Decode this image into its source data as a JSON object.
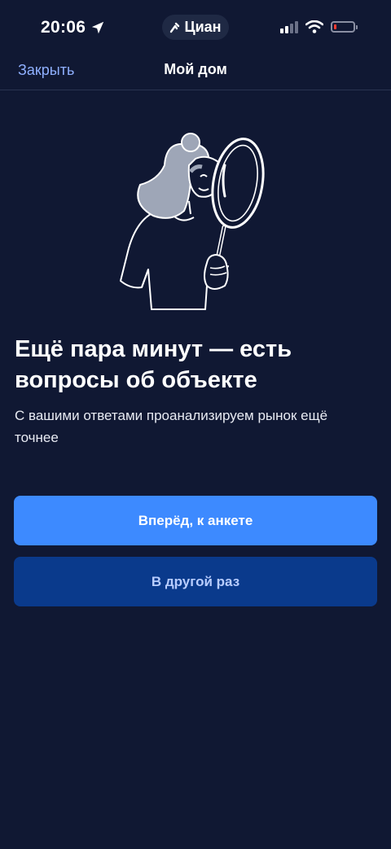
{
  "status_bar": {
    "time": "20:06",
    "app_pill": "Циан",
    "battery_level": 0.15
  },
  "nav": {
    "close_label": "Закрыть",
    "title": "Мой дом"
  },
  "content": {
    "headline": "Ещё пара минут — есть вопросы об объекте",
    "subtitle": "С вашими ответами проанализируем рынок ещё точнее"
  },
  "actions": {
    "primary_label": "Вперёд, к анкете",
    "secondary_label": "В другой раз"
  },
  "colors": {
    "background": "#101833",
    "primary_button": "#3d8aff",
    "secondary_button": "#0a3a8c",
    "link": "#8fb0ff"
  }
}
